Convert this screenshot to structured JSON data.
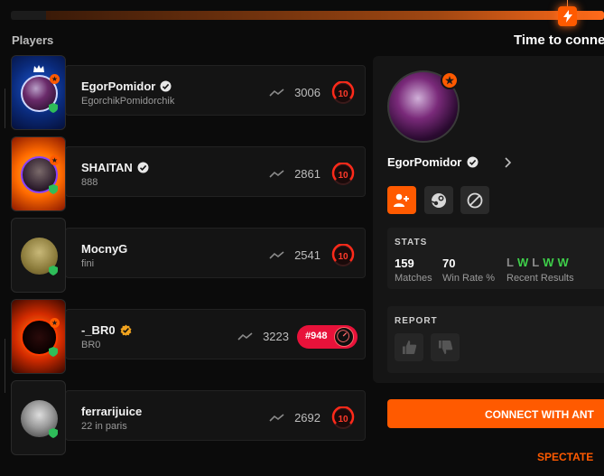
{
  "header": {
    "players_title": "Players",
    "time_title": "Time to conne",
    "progress": 0.94
  },
  "players": [
    {
      "name": "EgorPomidor",
      "sub": "EgorchikPomidorchik",
      "elo": "3006",
      "level": "10",
      "verified": "white"
    },
    {
      "name": "SHAITAN",
      "sub": "888",
      "elo": "2861",
      "level": "10",
      "verified": "white"
    },
    {
      "name": "MocnyG",
      "sub": "fini",
      "elo": "2541",
      "level": "10",
      "verified": "none"
    },
    {
      "name": "-_BR0",
      "sub": "BR0",
      "elo": "3223",
      "level": "#948",
      "verified": "gold"
    },
    {
      "name": "ferrarijuice",
      "sub": "22 in paris",
      "elo": "2692",
      "level": "10",
      "verified": "none"
    }
  ],
  "profile": {
    "name": "EgorPomidor",
    "stats_label": "STATS",
    "matches_value": "159",
    "matches_label": "Matches",
    "winrate_value": "70",
    "winrate_label": "Win Rate %",
    "recent_label": "Recent Results",
    "recent_results": [
      "L",
      "W",
      "L",
      "W",
      "W"
    ],
    "report_label": "REPORT"
  },
  "actions": {
    "connect_label": "CONNECT WITH ANT",
    "spectate_label": "SPECTATE"
  },
  "colors": {
    "accent": "#ff5a00",
    "win": "#3ecf4a",
    "loss": "#8a8a8a",
    "rank_pill": "#e8123a"
  },
  "icons": {
    "progress_marker": "lightning-icon",
    "elo": "trend-icon",
    "verified": "verified-check-icon",
    "add_friend": "add-friend-icon",
    "steam": "steam-icon",
    "block": "block-icon",
    "thumb_up": "thumbs-up-icon",
    "thumb_down": "thumbs-down-icon"
  }
}
